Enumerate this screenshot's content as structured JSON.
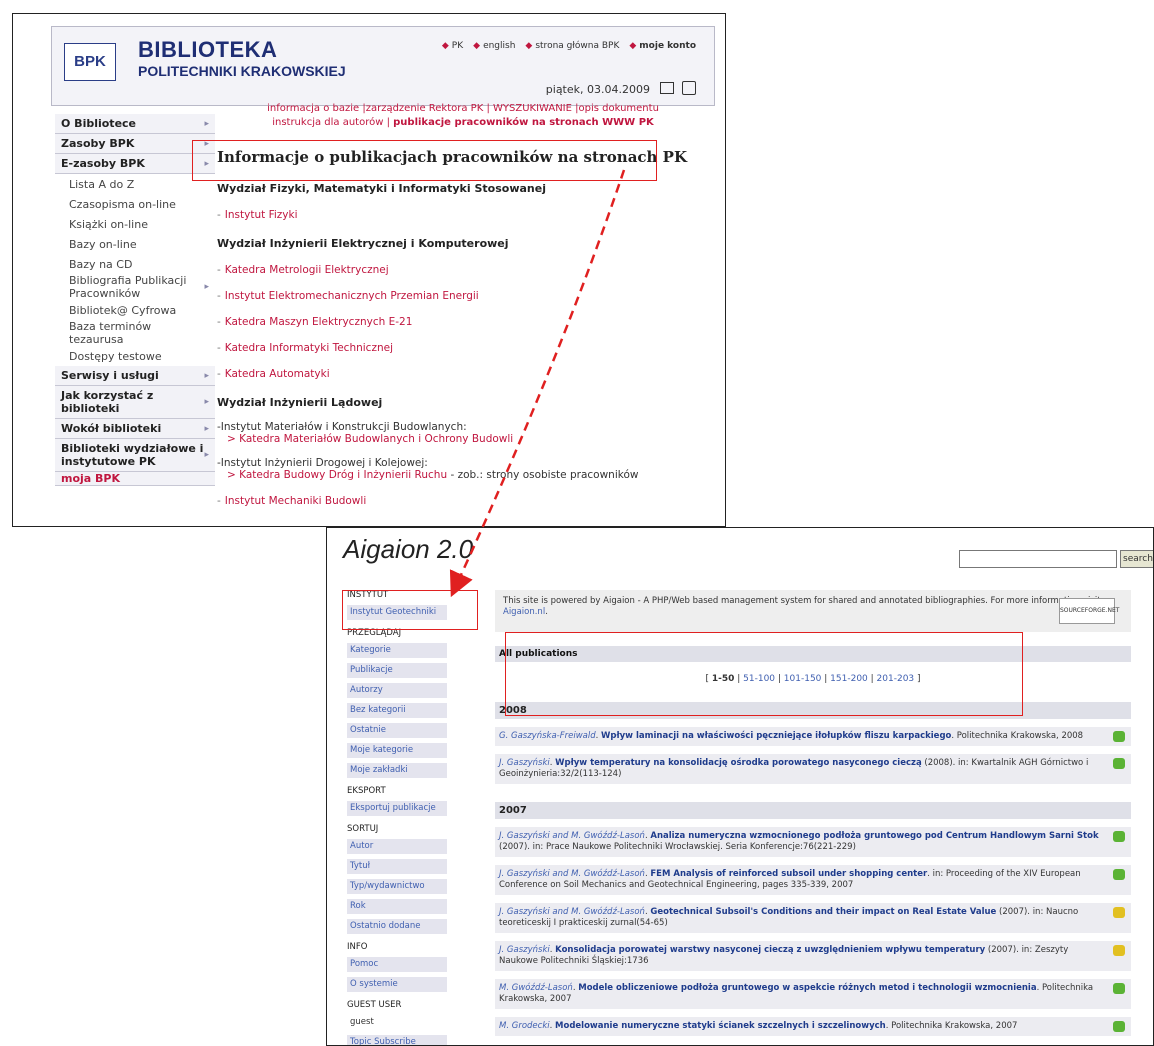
{
  "bpk": {
    "logo": "BPK",
    "title1": "BIBLIOTEKA",
    "title2": "POLITECHNIKI KRAKOWSKIEJ",
    "header_links": [
      "PK",
      "english",
      "strona główna BPK",
      "moje konto"
    ],
    "date": "piątek, 03.04.2009",
    "sidebar": [
      {
        "label": "O Bibliotece",
        "type": "bold"
      },
      {
        "label": "Zasoby BPK",
        "type": "bold"
      },
      {
        "label": "E-zasoby BPK",
        "type": "bold"
      },
      {
        "label": "Lista A do Z",
        "type": "sub"
      },
      {
        "label": "Czasopisma on-line",
        "type": "sub"
      },
      {
        "label": "Książki on-line",
        "type": "sub"
      },
      {
        "label": "Bazy on-line",
        "type": "sub"
      },
      {
        "label": "Bazy na CD",
        "type": "sub"
      },
      {
        "label": "Bibliografia Publikacji Pracowników",
        "type": "sub"
      },
      {
        "label": "Bibliotek@ Cyfrowa",
        "type": "sub"
      },
      {
        "label": "Baza terminów tezaurusa",
        "type": "sub"
      },
      {
        "label": "Dostępy testowe",
        "type": "sub"
      },
      {
        "label": "Serwisy i usługi",
        "type": "bold"
      },
      {
        "label": "Jak korzystać z biblioteki",
        "type": "bold"
      },
      {
        "label": "Wokół biblioteki",
        "type": "bold"
      },
      {
        "label": "Biblioteki wydziałowe i instytutowe PK",
        "type": "bold"
      },
      {
        "label": "moja BPK",
        "type": "mine"
      }
    ],
    "topnav_line1": "informacja o bazie |zarządzenie Rektora PK | WYSZUKIWANIE |opis dokumentu",
    "topnav_line2a": "instrukcja dla autorów |",
    "topnav_line2b": "publikacje pracowników na stronach WWW PK",
    "page_title": "Informacje o publikacjach pracowników na stronach PK",
    "dept1": "Wydział Fizyki, Matematyki i Informatyki Stosowanej",
    "dept1_items": [
      "Instytut Fizyki"
    ],
    "dept2": "Wydział Inżynierii Elektrycznej i Komputerowej",
    "dept2_items": [
      "Katedra Metrologii Elektrycznej",
      "Instytut Elektromechanicznych Przemian Energii",
      "Katedra Maszyn Elektrycznych E-21",
      "Katedra Informatyki Technicznej",
      "Katedra Automatyki"
    ],
    "dept3": "Wydział Inżynierii Lądowej",
    "inst1": "-Instytut Materiałów i Konstrukcji Budowlanych:",
    "inst1_sub": "> Katedra Materiałów Budowlanych i Ochrony Budowli",
    "inst2": "-Instytut Inżynierii Drogowej i Kolejowej:",
    "inst2_sub": "> Katedra Budowy Dróg i Inżynierii Ruchu",
    "inst2_note": " - zob.: strony osobiste pracowników",
    "inst3": "Instytut Mechaniki Budowli"
  },
  "aig": {
    "logo": "Aigaion 2.0",
    "search_label": "search",
    "sidebar": [
      {
        "title": "INSTYTUT",
        "items": [
          {
            "label": "Instytut Geotechniki"
          }
        ]
      },
      {
        "title": "PRZEGLĄDAJ",
        "items": [
          {
            "label": "Kategorie"
          },
          {
            "label": "Publikacje"
          },
          {
            "label": "Autorzy"
          },
          {
            "label": "Bez kategorii"
          },
          {
            "label": "Ostatnie"
          },
          {
            "label": "Moje kategorie"
          },
          {
            "label": "Moje zakładki"
          }
        ]
      },
      {
        "title": "EKSPORT",
        "items": [
          {
            "label": "Eksportuj publikacje"
          }
        ]
      },
      {
        "title": "SORTUJ",
        "items": [
          {
            "label": "Autor"
          },
          {
            "label": "Tytuł"
          },
          {
            "label": "Typ/wydawnictwo"
          },
          {
            "label": "Rok"
          },
          {
            "label": "Ostatnio dodane"
          }
        ]
      },
      {
        "title": "INFO",
        "items": [
          {
            "label": "Pomoc"
          },
          {
            "label": "O systemie"
          }
        ]
      },
      {
        "title": "GUEST USER",
        "items": [
          {
            "label": "guest",
            "plain": true
          },
          {
            "label": "Topic Subscribe"
          }
        ]
      }
    ],
    "powered_text": "This site is powered by Aigaion - A PHP/Web based management system for shared and annotated bibliographies. For more information visit ",
    "powered_link": "Aigaion.nl",
    "sourceforge": "SOURCEFORGE.NET",
    "all_pubs": "All publications",
    "pages": [
      "1-50",
      "51-100",
      "101-150",
      "151-200",
      "201-203"
    ],
    "years": [
      {
        "year": "2008",
        "entries": [
          {
            "authors": "G. Gaszyńska-Freiwald",
            "title": "Wpływ laminacji na właściwości pęczniejące iłołupków fliszu karpackiego",
            "rest": ". Politechnika Krakowska, 2008",
            "icon": "green"
          },
          {
            "authors": "J. Gaszyński",
            "title": "Wpływ temperatury na konsolidację ośrodka porowatego nasyconego cieczą",
            "rest": " (2008). in: Kwartalnik AGH Górnictwo i Geoinżynieria:32/2(113-124)",
            "icon": "green"
          }
        ]
      },
      {
        "year": "2007",
        "entries": [
          {
            "authors": "J. Gaszyński and M. Gwóźdź-Lasoń",
            "title": "Analiza numeryczna wzmocnionego podłoża gruntowego pod Centrum Handlowym Sarni Stok",
            "rest": " (2007). in: Prace Naukowe Politechniki Wrocławskiej. Seria Konferencje:76(221-229)",
            "icon": "green"
          },
          {
            "authors": "J. Gaszyński and M. Gwóźdź-Lasoń",
            "title": "FEM Analysis of reinforced subsoil under shopping center",
            "rest": ". in: Proceeding of the XIV European Conference on Soil Mechanics and Geotechnical Engineering, pages 335-339, 2007",
            "icon": "green"
          },
          {
            "authors": "J. Gaszyński and M. Gwóźdź-Lasoń",
            "title": "Geotechnical Subsoil's Conditions and their impact on Real Estate Value",
            "rest": " (2007). in: Naucno teoreticeskij I prakticeskij zurnal(54-65)",
            "icon": "yellow"
          },
          {
            "authors": "J. Gaszyński",
            "title": "Konsolidacja porowatej warstwy nasyconej cieczą z uwzględnieniem wpływu temperatury",
            "rest": " (2007). in: Zeszyty Naukowe Politechniki Śląskiej:1736",
            "icon": "yellow"
          },
          {
            "authors": "M. Gwóźdź-Lasoń",
            "title": "Modele obliczeniowe podłoża gruntowego w aspekcie różnych metod i technologii wzmocnienia",
            "rest": ". Politechnika Krakowska, 2007",
            "icon": "green"
          },
          {
            "authors": "M. Grodecki",
            "title": "Modelowanie numeryczne statyki ścianek szczelnych i szczelinowych",
            "rest": ". Politechnika Krakowska, 2007",
            "icon": "green"
          }
        ]
      }
    ]
  },
  "colors": {
    "accent_red": "#c0163f",
    "navy": "#1f2e74",
    "link_blue": "#3f5fb0",
    "annotation_red": "#e02020"
  }
}
